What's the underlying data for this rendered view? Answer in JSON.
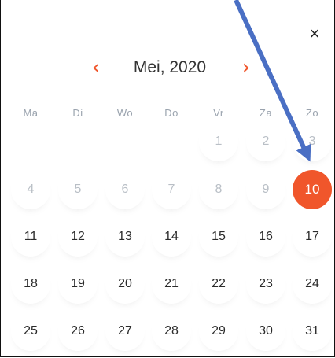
{
  "dialog": {
    "close_label": "×",
    "month_label": "Mei, 2020",
    "prev_label": "‹",
    "next_label": "›"
  },
  "weekdays": [
    "Ma",
    "Di",
    "Wo",
    "Do",
    "Vr",
    "Za",
    "Zo"
  ],
  "weeks": [
    [
      null,
      null,
      null,
      null,
      "1",
      "2",
      "3"
    ],
    [
      "4",
      "5",
      "6",
      "7",
      "8",
      "9",
      "10"
    ],
    [
      "11",
      "12",
      "13",
      "14",
      "15",
      "16",
      "17"
    ],
    [
      "18",
      "19",
      "20",
      "21",
      "22",
      "23",
      "24"
    ],
    [
      "25",
      "26",
      "27",
      "28",
      "29",
      "30",
      "31"
    ]
  ],
  "selected_day": "10",
  "disabled_days": [
    "1",
    "2",
    "3",
    "4",
    "5",
    "6",
    "7",
    "8",
    "9"
  ],
  "colors": {
    "accent": "#f0562b",
    "weekday": "#9aa3ae",
    "disabled": "#b9bfc6",
    "text": "#2b2b2b",
    "annotation_arrow": "#4a6fc4"
  },
  "icons": {
    "close": "close-icon",
    "prev": "chevron-left-icon",
    "next": "chevron-right-icon",
    "annotation": "arrow-pointer-annotation"
  }
}
